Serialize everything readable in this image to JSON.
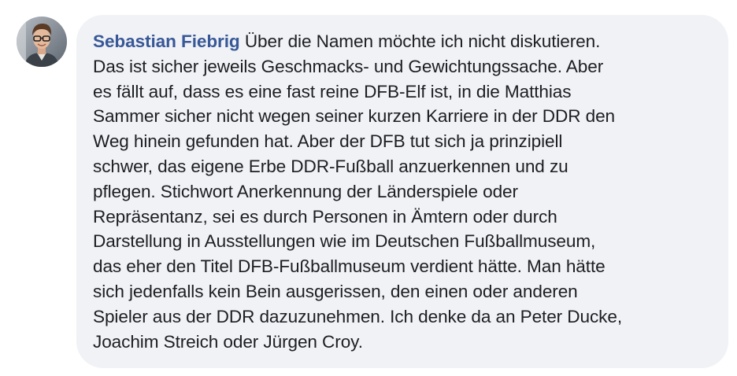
{
  "comment": {
    "author": "Sebastian Fiebrig",
    "text": "Über die Namen möchte ich nicht diskutieren.\nDas ist sicher jeweils Geschmacks- und Gewichtungssache. Aber\nes fällt auf, dass es eine fast reine DFB-Elf ist, in die Matthias\nSammer sicher nicht wegen seiner kurzen Karriere in der DDR den\nWeg hinein gefunden hat. Aber der DFB tut sich ja prinzipiell\nschwer, das eigene Erbe DDR-Fußball anzuerkennen und zu\npflegen. Stichwort Anerkennung der Länderspiele oder\nRepräsentanz, sei es durch Personen in Ämtern oder durch\nDarstellung in Ausstellungen wie im Deutschen Fußballmuseum,\ndas eher den Titel DFB-Fußballmuseum verdient hätte. Man hätte\nsich jedenfalls kein Bein ausgerissen, den einen oder anderen\nSpieler aus der DDR dazuzunehmen. Ich denke da an Peter Ducke,\nJoachim Streich oder Jürgen Croy."
  },
  "colors": {
    "author_link": "#385898",
    "bubble_background": "#f0f2f5",
    "text": "#1c1e21"
  },
  "icons": {
    "avatar": "profile-photo-man-with-glasses"
  }
}
